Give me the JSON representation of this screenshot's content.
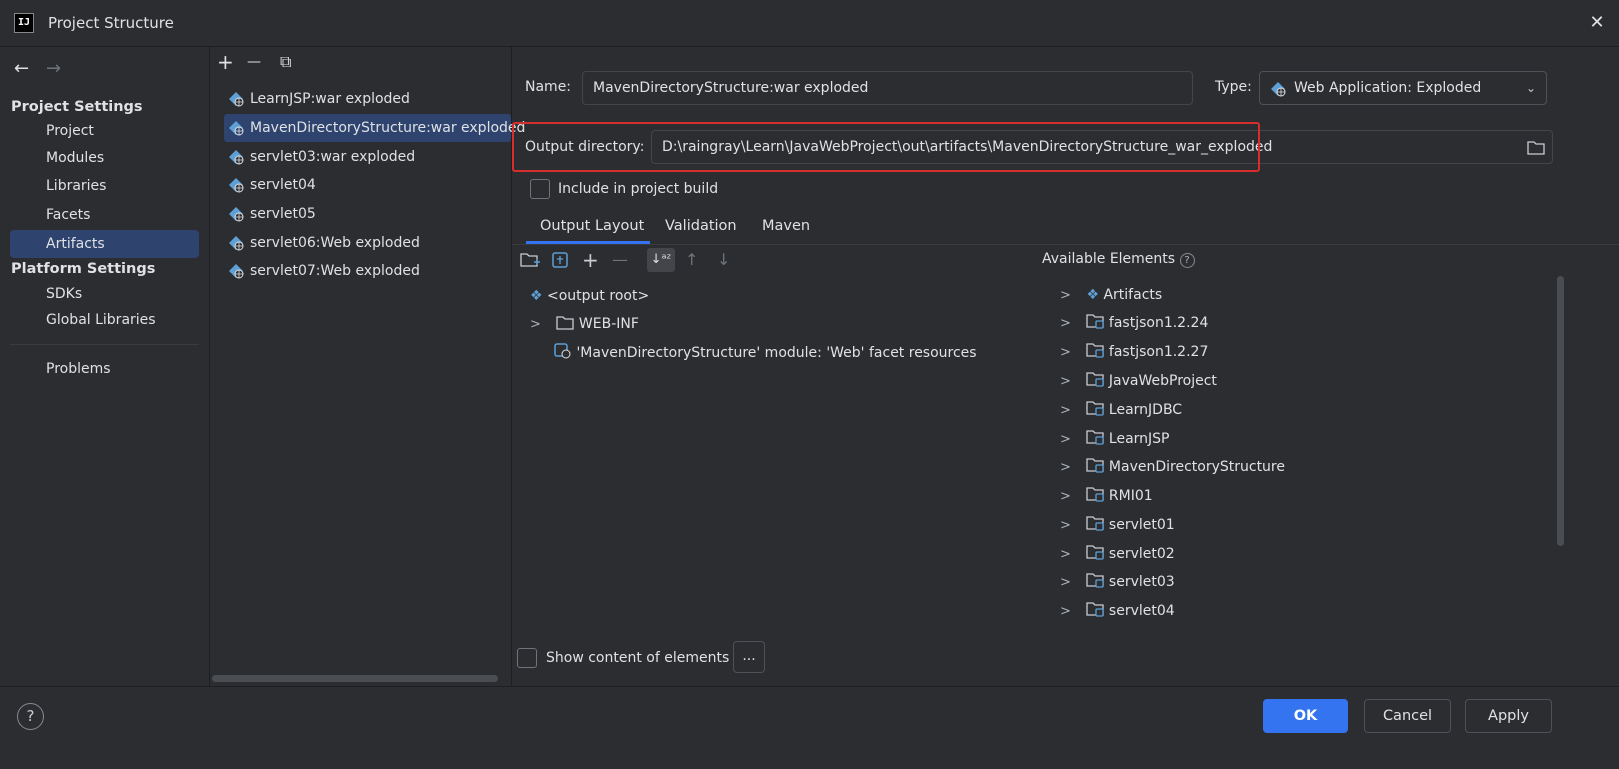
{
  "window": {
    "title": "Project Structure",
    "app_icon": "IJ",
    "close": "✕"
  },
  "nav": {
    "back": "←",
    "forward": "→",
    "project_settings_header": "Project Settings",
    "project_items": [
      "Project",
      "Modules",
      "Libraries",
      "Facets",
      "Artifacts"
    ],
    "platform_settings_header": "Platform Settings",
    "platform_items": [
      "SDKs",
      "Global Libraries"
    ],
    "problems": "Problems",
    "selected": "Artifacts"
  },
  "artifact_toolbar": {
    "add": "+",
    "remove": "—",
    "copy": "⧉"
  },
  "artifacts": [
    "LearnJSP:war exploded",
    "MavenDirectoryStructure:war exploded",
    "servlet03:war exploded",
    "servlet04",
    "servlet05",
    "servlet06:Web exploded",
    "servlet07:Web exploded"
  ],
  "detail": {
    "name_label": "Name:",
    "name_value": "MavenDirectoryStructure:war exploded",
    "type_label": "Type:",
    "type_value": "Web Application: Exploded",
    "output_dir_label": "Output directory:",
    "output_dir_value": "D:\\raingray\\Learn\\JavaWebProject\\out\\artifacts\\MavenDirectoryStructure_war_exploded",
    "include_build_label": "Include in project build",
    "include_build_checked": false,
    "tabs": [
      "Output Layout",
      "Validation",
      "Maven"
    ],
    "active_tab": "Output Layout",
    "layout_tree": [
      {
        "label": "<output root>",
        "icon": "output-root-icon",
        "expandable": false
      },
      {
        "label": "WEB-INF",
        "icon": "folder-icon",
        "expandable": true
      },
      {
        "label": "'MavenDirectoryStructure' module: 'Web' facet resources",
        "icon": "web-facet-icon",
        "expandable": false
      }
    ],
    "available_elements_label": "Available Elements",
    "available_elements": [
      "Artifacts",
      "fastjson1.2.24",
      "fastjson1.2.27",
      "JavaWebProject",
      "LearnJDBC",
      "LearnJSP",
      "MavenDirectoryStructure",
      "RMI01",
      "servlet01",
      "servlet02",
      "servlet03",
      "servlet04"
    ],
    "show_content_label": "Show content of elements",
    "more_button": "..."
  },
  "footer": {
    "help": "?",
    "ok": "OK",
    "cancel": "Cancel",
    "apply": "Apply"
  },
  "colors": {
    "accent": "#3574f0",
    "selection": "#2e436e",
    "highlight_box": "#d62d2d",
    "background": "#2b2d30"
  }
}
